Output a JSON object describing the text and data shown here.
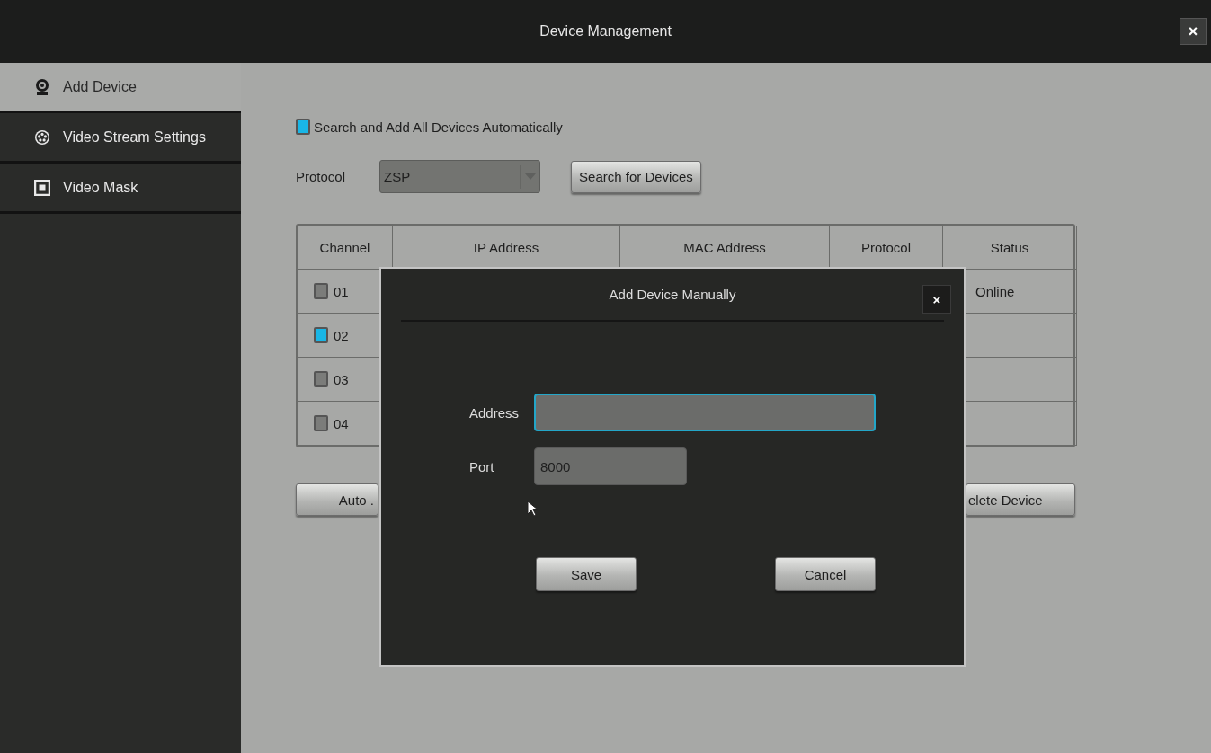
{
  "window": {
    "title": "Device Management",
    "close": "×"
  },
  "sidebar": {
    "items": [
      {
        "label": "Add Device",
        "kind": "camera",
        "selected": true
      },
      {
        "label": "Video Stream Settings",
        "kind": "reel",
        "selected": false
      },
      {
        "label": "Video Mask",
        "kind": "mask",
        "selected": false
      }
    ]
  },
  "auto_search": {
    "label": "Search and Add All Devices Automatically",
    "checked": true
  },
  "protocol": {
    "label": "Protocol",
    "value": "ZSP"
  },
  "search_button": "Search for Devices",
  "table": {
    "columns": [
      "Channel",
      "IP Address",
      "MAC Address",
      "Protocol",
      "Status"
    ],
    "rows": [
      {
        "channel": "01",
        "checked": false,
        "status": "Online"
      },
      {
        "channel": "02",
        "checked": true
      },
      {
        "channel": "03",
        "checked": false
      },
      {
        "channel": "04",
        "checked": false
      }
    ]
  },
  "bottom_buttons": [
    "Auto .",
    "elete Device"
  ],
  "dialog": {
    "title": "Add Device Manually",
    "close": "×",
    "address_label": "Address",
    "address_focused": true,
    "port_label": "Port",
    "port_value": "8000",
    "buttons": [
      "Save",
      "Cancel"
    ]
  }
}
